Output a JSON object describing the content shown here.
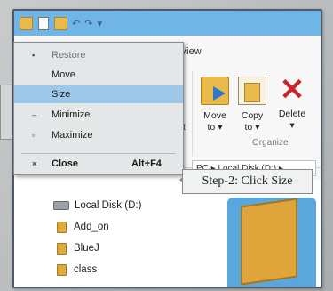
{
  "ribbon": {
    "view_tab": "View",
    "move_label": "Move",
    "move_sub": "to ▾",
    "copy_label": "Copy",
    "copy_sub": "to ▾",
    "delete_label": "Delete",
    "delete_sub": "▾",
    "organize_group": "Organize",
    "partial_letter": "t"
  },
  "address": {
    "path": "PC ▸ Local Disk (D:) ▸"
  },
  "system_menu": {
    "items": [
      {
        "label": "Restore",
        "symbol": "▪",
        "state": "disabled"
      },
      {
        "label": "Move",
        "symbol": "",
        "state": "normal"
      },
      {
        "label": "Size",
        "symbol": "",
        "state": "selected"
      },
      {
        "label": "Minimize",
        "symbol": "–",
        "state": "normal"
      },
      {
        "label": "Maximize",
        "symbol": "▫",
        "state": "normal"
      },
      {
        "label": "Close",
        "symbol": "×",
        "state": "normal",
        "shortcut": "Alt+F4"
      }
    ]
  },
  "nav_tree": {
    "items": [
      {
        "label": "Local Disk (D:)",
        "icon": "drive-icon"
      },
      {
        "label": "Add_on",
        "icon": "folder-icon"
      },
      {
        "label": "BlueJ",
        "icon": "folder-icon"
      },
      {
        "label": "class",
        "icon": "folder-icon"
      }
    ]
  },
  "callout": {
    "text": "Step-2: Click Size"
  },
  "colors": {
    "titlebar": "#6fb5e6",
    "menu_highlight": "#9ec8ea",
    "delete_x": "#c8262e"
  }
}
